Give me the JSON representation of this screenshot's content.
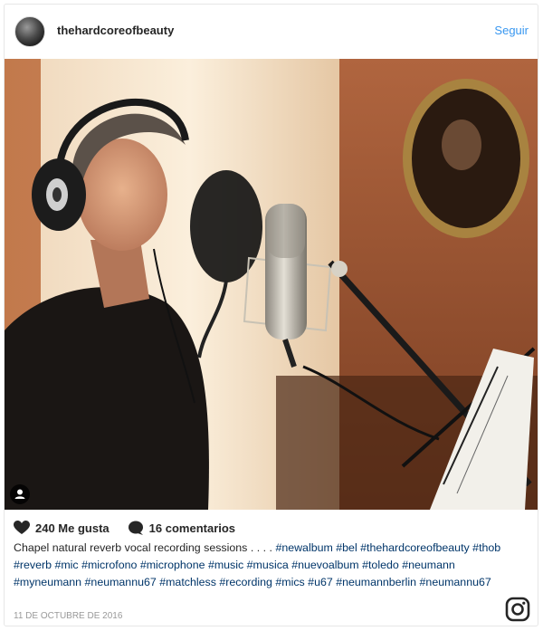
{
  "header": {
    "username": "thehardcoreofbeauty",
    "follow_label": "Seguir"
  },
  "post": {
    "image_alt": "Singer with headphones at a studio microphone",
    "likes_label": "240 Me gusta",
    "comments_label": "16 comentarios",
    "caption": "Chapel natural reverb vocal recording sessions . . . . #newalbum #bel #thehardcoreofbeauty #thob #reverb #mic #microfono #microphone #music #musica #nuevoalbum #toledo #neumann #myneumann #neumannu67 #matchless #recording #mics #u67 #neumannberlin #neumannu67",
    "date": "11 DE OCTUBRE DE 2016"
  },
  "icons": {
    "avatar": "avatar",
    "heart": "heart-icon",
    "comment": "comment-bubble-icon",
    "user_tag": "user-tag-icon",
    "instagram": "instagram-logo-icon"
  },
  "colors": {
    "accent": "#3897f0",
    "text": "#262626",
    "muted": "#999999"
  }
}
